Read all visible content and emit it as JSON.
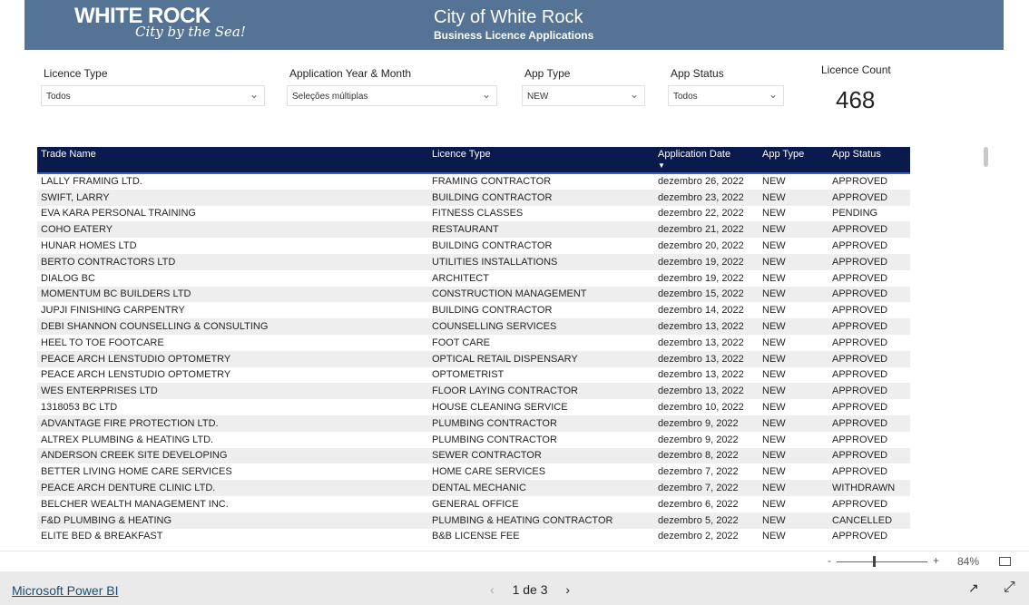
{
  "header": {
    "logo_main": "WHITE ROCK",
    "logo_tagline": "City by the Sea!",
    "title": "City of White Rock",
    "subtitle": "Business Licence Applications",
    "color": "#557394"
  },
  "filters": [
    {
      "label": "Licence Type",
      "value": "Todos"
    },
    {
      "label": "Application Year & Month",
      "value": "Seleções múltiplas"
    },
    {
      "label": "App Type",
      "value": "NEW"
    },
    {
      "label": "App Status",
      "value": "Todos"
    }
  ],
  "card": {
    "label": "Licence Count",
    "value": "468"
  },
  "table": {
    "columns": [
      "Trade Name",
      "Licence Type",
      "Application Date",
      "App Type",
      "App Status"
    ],
    "sort_indicator": "▼",
    "rows": [
      [
        "LALLY FRAMING LTD.",
        "FRAMING CONTRACTOR",
        "dezembro 26, 2022",
        "NEW",
        "APPROVED"
      ],
      [
        "SWIFT, LARRY",
        "BUILDING CONTRACTOR",
        "dezembro 23, 2022",
        "NEW",
        "APPROVED"
      ],
      [
        "EVA KARA PERSONAL TRAINING",
        "FITNESS CLASSES",
        "dezembro 22, 2022",
        "NEW",
        "PENDING"
      ],
      [
        "COHO EATERY",
        "RESTAURANT",
        "dezembro 21, 2022",
        "NEW",
        "APPROVED"
      ],
      [
        "HUNAR HOMES LTD",
        "BUILDING CONTRACTOR",
        "dezembro 20, 2022",
        "NEW",
        "APPROVED"
      ],
      [
        "BERTO CONTRACTORS LTD",
        "UTILITIES INSTALLATIONS",
        "dezembro 19, 2022",
        "NEW",
        "APPROVED"
      ],
      [
        "DIALOG BC",
        "ARCHITECT",
        "dezembro 19, 2022",
        "NEW",
        "APPROVED"
      ],
      [
        "MOMENTUM BC BUILDERS LTD",
        "CONSTRUCTION MANAGEMENT",
        "dezembro 15, 2022",
        "NEW",
        "APPROVED"
      ],
      [
        "JUPJI FINISHING CARPENTRY",
        "BUILDING CONTRACTOR",
        "dezembro 14, 2022",
        "NEW",
        "APPROVED"
      ],
      [
        "DEBI SHANNON COUNSELLING & CONSULTING",
        "COUNSELLING SERVICES",
        "dezembro 13, 2022",
        "NEW",
        "APPROVED"
      ],
      [
        "HEEL TO TOE FOOTCARE",
        "FOOT CARE",
        "dezembro 13, 2022",
        "NEW",
        "APPROVED"
      ],
      [
        "PEACE ARCH LENSTUDIO OPTOMETRY",
        "OPTICAL RETAIL DISPENSARY",
        "dezembro 13, 2022",
        "NEW",
        "APPROVED"
      ],
      [
        "PEACE ARCH LENSTUDIO OPTOMETRY",
        "OPTOMETRIST",
        "dezembro 13, 2022",
        "NEW",
        "APPROVED"
      ],
      [
        "WES ENTERPRISES LTD",
        "FLOOR LAYING CONTRACTOR",
        "dezembro 13, 2022",
        "NEW",
        "APPROVED"
      ],
      [
        "1318053 BC LTD",
        "HOUSE CLEANING SERVICE",
        "dezembro 10, 2022",
        "NEW",
        "APPROVED"
      ],
      [
        "ADVANTAGE FIRE PROTECTION LTD.",
        "PLUMBING CONTRACTOR",
        "dezembro 9, 2022",
        "NEW",
        "APPROVED"
      ],
      [
        "ALTREX PLUMBING & HEATING LTD.",
        "PLUMBING CONTRACTOR",
        "dezembro 9, 2022",
        "NEW",
        "APPROVED"
      ],
      [
        "ANDERSON CREEK SITE DEVELOPING",
        "SEWER CONTRACTOR",
        "dezembro 8, 2022",
        "NEW",
        "APPROVED"
      ],
      [
        "BETTER LIVING HOME CARE SERVICES",
        "HOME CARE SERVICES",
        "dezembro 7, 2022",
        "NEW",
        "APPROVED"
      ],
      [
        "PEACE ARCH DENTURE CLINIC LTD.",
        "DENTAL MECHANIC",
        "dezembro 7, 2022",
        "NEW",
        "WITHDRAWN"
      ],
      [
        "BELCHER WEALTH MANAGEMENT INC.",
        "GENERAL OFFICE",
        "dezembro 6, 2022",
        "NEW",
        "APPROVED"
      ],
      [
        "F&D PLUMBING & HEATING",
        "PLUMBING & HEATING CONTRACTOR",
        "dezembro 5, 2022",
        "NEW",
        "CANCELLED"
      ],
      [
        "ELITE BED & BREAKFAST",
        "B&B LICENSE FEE",
        "dezembro 2, 2022",
        "NEW",
        "APPROVED"
      ]
    ]
  },
  "zoom": {
    "minus": "-",
    "plus": "+",
    "level": "84%",
    "level_value": 84
  },
  "footer": {
    "brand": "Microsoft Power BI",
    "page": "1 de 3",
    "prev": "‹",
    "next": "›"
  }
}
